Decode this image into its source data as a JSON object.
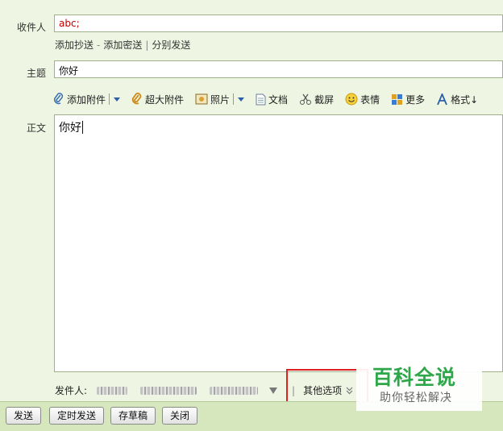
{
  "labels": {
    "to": "收件人",
    "subject": "主题",
    "body": "正文",
    "sender": "发件人:"
  },
  "to_value": "abc;",
  "recipient_links": {
    "cc": "添加抄送",
    "dash": "-",
    "bcc": "添加密送",
    "bar": "|",
    "separate": "分别发送"
  },
  "subject_value": "你好",
  "body_value": "你好",
  "toolbar": {
    "attach": "添加附件",
    "big_attach": "超大附件",
    "photo": "照片",
    "doc": "文档",
    "screenshot": "截屏",
    "emoji": "表情",
    "more": "更多",
    "format": "格式↓"
  },
  "other_options": "其他选项",
  "buttons": {
    "send": "发送",
    "scheduled": "定时发送",
    "draft": "存草稿",
    "close": "关闭"
  },
  "watermark": {
    "title": "百科全说",
    "subtitle": "助你轻松解决"
  },
  "colors": {
    "accent": "#2ea64a",
    "highlight": "#e02020",
    "to_text": "#c00000",
    "background": "#eef5e2"
  }
}
